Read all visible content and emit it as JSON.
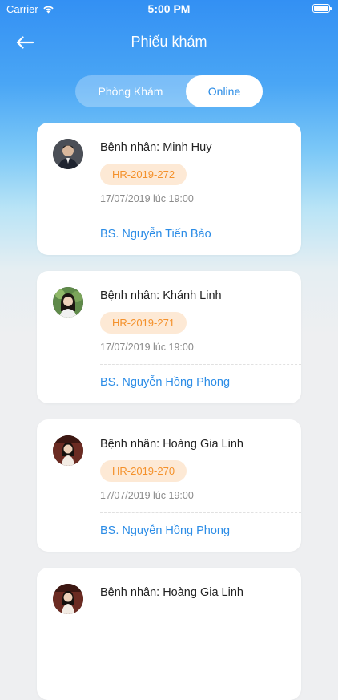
{
  "status_bar": {
    "carrier": "Carrier",
    "time": "5:00 PM",
    "wifi_icon": "wifi-icon",
    "battery_icon": "battery-icon"
  },
  "nav": {
    "back_icon": "arrow-left-icon",
    "title": "Phiếu khám"
  },
  "tabs": {
    "items": [
      {
        "label": "Phòng Khám",
        "selected": false
      },
      {
        "label": "Online",
        "selected": true
      }
    ]
  },
  "colors": {
    "accent": "#2b8ce6",
    "badge_bg": "#fde9d5",
    "badge_text": "#f4912b",
    "header_top": "#3390f3"
  },
  "records": [
    {
      "patient": "Bệnh nhân: Minh Huy",
      "code": "HR-2019-272",
      "datetime": "17/07/2019 lúc 19:00",
      "doctor": "BS. Nguyễn Tiến Bảo"
    },
    {
      "patient": "Bệnh nhân: Khánh Linh",
      "code": "HR-2019-271",
      "datetime": "17/07/2019 lúc 19:00",
      "doctor": "BS. Nguyễn Hồng Phong"
    },
    {
      "patient": "Bệnh nhân: Hoàng Gia Linh",
      "code": "HR-2019-270",
      "datetime": "17/07/2019 lúc 19:00",
      "doctor": "BS. Nguyễn Hồng Phong"
    },
    {
      "patient": "Bệnh nhân: Hoàng Gia Linh"
    }
  ]
}
